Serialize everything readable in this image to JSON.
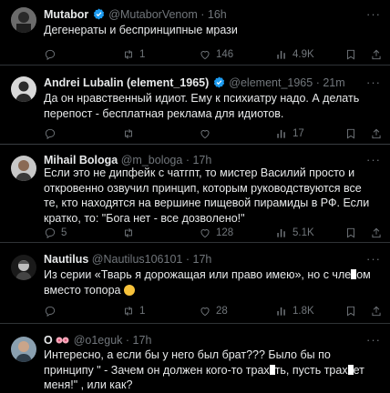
{
  "tweets": [
    {
      "name": "Mutabor",
      "verified": true,
      "handle": "@MutaborVenom",
      "time": "16h",
      "text": "Дегенераты и беспринципные мрази",
      "reply_count": "",
      "retweet_count": "1",
      "like_count": "146",
      "view_count": "4.9K"
    },
    {
      "name": "Andrei Lubalin (element_1965)",
      "verified": true,
      "handle": "@element_1965",
      "time": "21m",
      "text": "Да он нравственный идиот. Ему к психиатру надо. А делать перепост - бесплатная реклама для идиотов.",
      "reply_count": "",
      "retweet_count": "",
      "like_count": "",
      "view_count": "17"
    },
    {
      "name": "Mihail Bologa",
      "verified": false,
      "handle": "@m_bologa",
      "time": "17h",
      "text": "Если это не дипфейк с чатгпт, то мистер Василий просто и откровенно озвучил принцип, которым руководствуются все те, кто находятся на вершине пищевой пирамиды в РФ. Если кратко, то: \"Бога нет - все дозволено!\"",
      "reply_count": "5",
      "retweet_count": "",
      "like_count": "128",
      "view_count": "5.1K"
    },
    {
      "name": "Nautilus",
      "verified": false,
      "handle": "@Nautilus106101",
      "time": "17h",
      "text_a": "Из серии «Тварь я дорожащая или право имею», но с чле",
      "text_b": "ом вместо топора",
      "reply_count": "",
      "retweet_count": "1",
      "like_count": "28",
      "view_count": "1.8K"
    },
    {
      "name": "O",
      "verified": false,
      "handle": "@o1eguk",
      "time": "17h",
      "text_a": "Интересно, а если бы у него был брат??? Было бы по принципу \" - Зачем он должен кого-то трах",
      "text_b": "ть, пусть трах",
      "text_c": "ет меня!\" , или как?"
    }
  ],
  "ui": {
    "dot": "·",
    "more": "···"
  },
  "colors": {
    "background": "#000000",
    "text": "#e7e9ea",
    "muted": "#71767b",
    "border": "#2f3336",
    "verified": "#1d9bf0"
  }
}
